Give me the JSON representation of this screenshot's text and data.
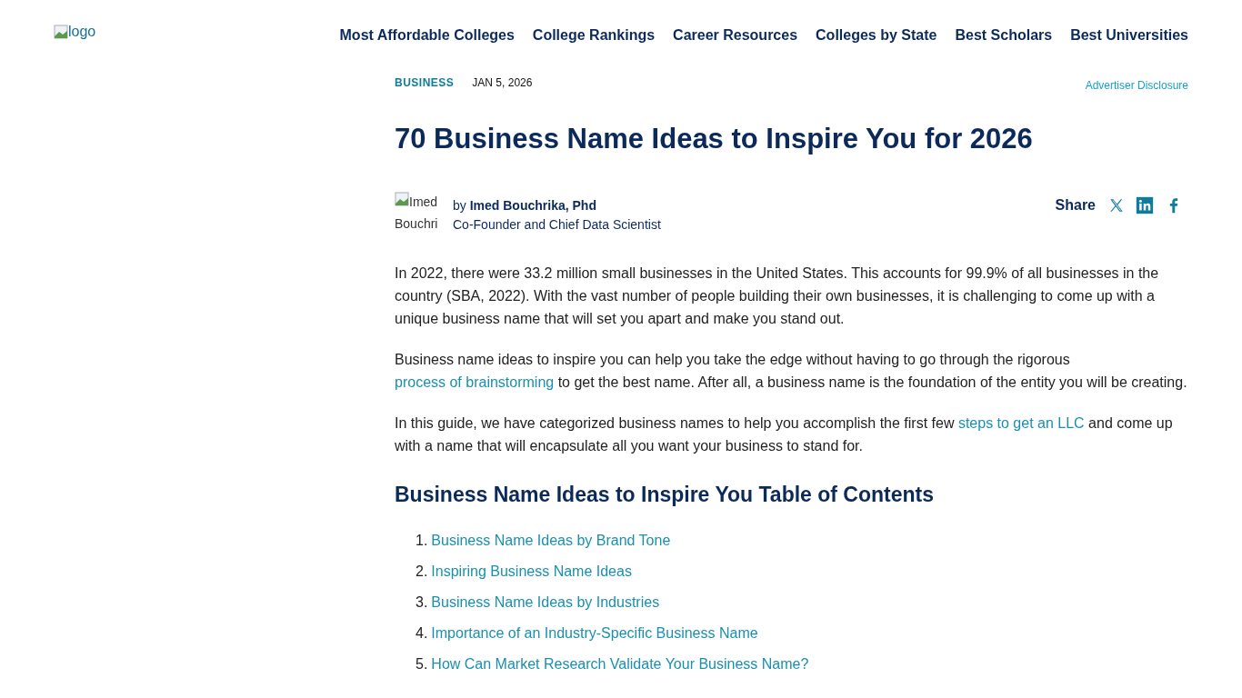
{
  "header": {
    "logo_alt": "logo",
    "nav": [
      "Most Affordable Colleges",
      "College Rankings",
      "Career Resources",
      "Colleges by State",
      "Best Scholars",
      "Best Universities"
    ]
  },
  "article": {
    "category": "BUSINESS",
    "date": "JAN 5, 2026",
    "disclosure": "Advertiser Disclosure",
    "title": "70 Business Name Ideas to Inspire You for 2026",
    "author": {
      "photo_alt": "Imed Bouchri",
      "by": "by",
      "name": "Imed Bouchrika, Phd",
      "role": "Co-Founder and Chief Data Scientist"
    },
    "share": {
      "label": "Share",
      "icons": [
        {
          "kind": "x"
        },
        {
          "kind": "linkedin"
        },
        {
          "kind": "facebook"
        }
      ]
    },
    "paragraphs": [
      [
        {
          "kind": "text",
          "text": "In 2022, there were 33.2 million small businesses in the United States. This accounts for 99.9% of all businesses in the country (SBA, 2022). With the vast number of people building their own businesses, it is challenging to come up with a unique business name that will set you apart and make you stand out."
        }
      ],
      [
        {
          "kind": "text",
          "text": "Business name ideas to inspire you can help you take the edge without having to go through the rigorous "
        },
        {
          "kind": "link",
          "text": "process of brainstorming"
        },
        {
          "kind": "text",
          "text": " to get the best name. After all, a business name is the foundation of the entity you will be creating."
        }
      ],
      [
        {
          "kind": "text",
          "text": "In this guide, we have categorized business names to help you accomplish the first few "
        },
        {
          "kind": "link",
          "text": "steps to get an LLC"
        },
        {
          "kind": "text",
          "text": " and come up with a name that will encapsulate all you want your business to stand for."
        }
      ]
    ],
    "toc": {
      "heading": "Business Name Ideas to Inspire You Table of Contents",
      "items": [
        {
          "number": "1.",
          "label": "Business Name Ideas by Brand Tone"
        },
        {
          "number": "2.",
          "label": "Inspiring Business Name Ideas"
        },
        {
          "number": "3.",
          "label": "Business Name Ideas by Industries"
        },
        {
          "number": "4.",
          "label": "Importance of an Industry-Specific Business Name"
        },
        {
          "number": "5.",
          "label": "How Can Market Research Validate Your Business Name?"
        }
      ]
    }
  }
}
